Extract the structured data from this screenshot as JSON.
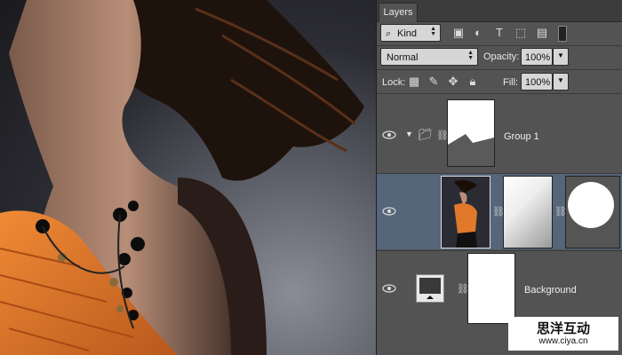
{
  "panel": {
    "tab_label": "Layers",
    "filter_kind": "Kind",
    "blend_mode": "Normal",
    "opacity_label": "Opacity:",
    "opacity_value": "100%",
    "lock_label": "Lock:",
    "fill_label": "Fill:",
    "fill_value": "100%"
  },
  "layers": [
    {
      "name": "Group 1",
      "type": "group",
      "selected": false
    },
    {
      "name": "",
      "type": "photo-with-masks",
      "selected": true
    },
    {
      "name": "Background",
      "type": "background",
      "selected": false
    }
  ],
  "watermark": {
    "line1": "思洋互动",
    "line2": "www.ciya.cn"
  },
  "colors": {
    "panel": "#535353",
    "selected_row": "#55657a",
    "orange_shirt": "#e07a2a"
  }
}
